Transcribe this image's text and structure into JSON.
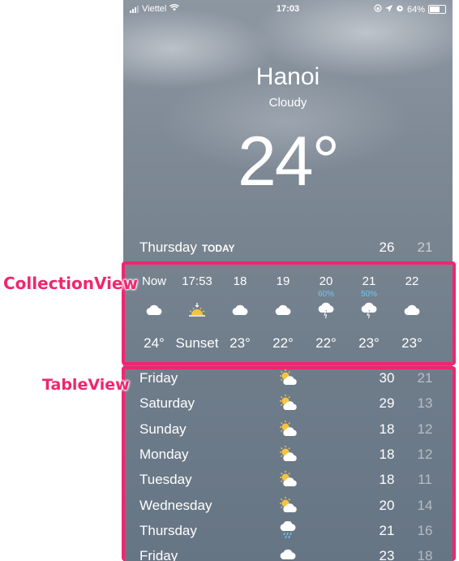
{
  "status_bar": {
    "carrier": "Viettel",
    "time": "17:03",
    "battery": "64%"
  },
  "current": {
    "city": "Hanoi",
    "condition": "Cloudy",
    "temperature": "24°"
  },
  "today": {
    "day": "Thursday",
    "tag": "TODAY",
    "high": "26",
    "low": "21"
  },
  "hourly": [
    {
      "time": "Now",
      "precip": "",
      "icon": "cloud-icon",
      "value": "24°"
    },
    {
      "time": "17:53",
      "precip": "",
      "icon": "sunset-icon",
      "value": "Sunset"
    },
    {
      "time": "18",
      "precip": "",
      "icon": "cloud-icon",
      "value": "23°"
    },
    {
      "time": "19",
      "precip": "",
      "icon": "cloud-icon",
      "value": "22°"
    },
    {
      "time": "20",
      "precip": "60%",
      "icon": "thunderstorm-icon",
      "value": "22°"
    },
    {
      "time": "21",
      "precip": "50%",
      "icon": "thunderstorm-icon",
      "value": "23°"
    },
    {
      "time": "22",
      "precip": "",
      "icon": "cloud-icon",
      "value": "23°"
    }
  ],
  "daily": [
    {
      "day": "Friday",
      "icon": "partly-cloudy-icon",
      "high": "30",
      "low": "21"
    },
    {
      "day": "Saturday",
      "icon": "partly-cloudy-icon",
      "high": "29",
      "low": "13"
    },
    {
      "day": "Sunday",
      "icon": "partly-cloudy-icon",
      "high": "18",
      "low": "12"
    },
    {
      "day": "Monday",
      "icon": "partly-cloudy-icon",
      "high": "18",
      "low": "12"
    },
    {
      "day": "Tuesday",
      "icon": "partly-cloudy-icon",
      "high": "18",
      "low": "11"
    },
    {
      "day": "Wednesday",
      "icon": "partly-cloudy-icon",
      "high": "20",
      "low": "14"
    },
    {
      "day": "Thursday",
      "icon": "rain-icon",
      "high": "21",
      "low": "16"
    },
    {
      "day": "Friday",
      "icon": "cloud-icon",
      "high": "23",
      "low": "18"
    }
  ],
  "annotations": {
    "collection_view": "CollectionView",
    "table_view": "TableView"
  },
  "colors": {
    "annotation": "#f0266e",
    "precip_text": "#6ec9f0",
    "sun": "#f6c343"
  }
}
